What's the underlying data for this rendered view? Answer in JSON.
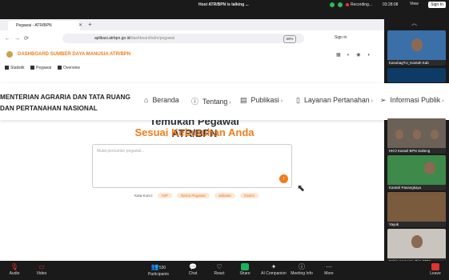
{
  "zoom": {
    "talking": "Host ATR/BPN is talking ...",
    "recording": "Recording...",
    "time": "03:28:08",
    "view": "View",
    "sign_in": "Sign In"
  },
  "browser": {
    "tab_title": "Pegawai - ATR/BPN",
    "url_domain": "aplikasi.atrbpn.go.id",
    "url_path": "/dashboard/sdm/pegawai",
    "zoom_level": "60%",
    "sign_in": "Sign in"
  },
  "app": {
    "title": "DASHBOARD SUMBER DAYA MANUSIA ATR/BPN",
    "subnav": [
      "Statistik",
      "Pegawai",
      "Overview"
    ]
  },
  "header": {
    "org_line1": "MENTERIAN AGRARIA DAN TATA RUANG",
    "org_line2": "DAN PERTANAHAN NASIONAL",
    "nav": [
      "Beranda",
      "Tentang",
      "Publikasi",
      "Layanan Pertanahan",
      "Informasi Publik"
    ]
  },
  "hero": {
    "line1": "Temukan Pegawai ATR/BPN",
    "line2": "Sesuai Kebutuhan Anda",
    "search_placeholder": "Mulai pencarian pegawai...",
    "keywords_label": "Kata Kunci:",
    "keywords": [
      "NIP",
      "Nama Pegawai",
      "Jabatan",
      "Kantor"
    ]
  },
  "participants": [
    "KasubagTU_Kantah Kab",
    "",
    "HKO Kanwil BPN Sulteng",
    "Kantah Pasangkayu",
    "Yayuk",
    "Sahia Aryawan_Biro SDM"
  ],
  "toolbar": {
    "audio": "Audio",
    "video": "Video",
    "participants_count": "530",
    "participants": "Participants",
    "chat": "Chat",
    "react": "React",
    "share": "Share",
    "ai": "AI Companion",
    "meeting_info": "Meeting Info",
    "more": "More",
    "leave": "Leave"
  },
  "colors": {
    "accent": "#f07d1a",
    "dark_text": "#2b2f3a",
    "share_green": "#1db25a",
    "leave_red": "#dd3333"
  }
}
